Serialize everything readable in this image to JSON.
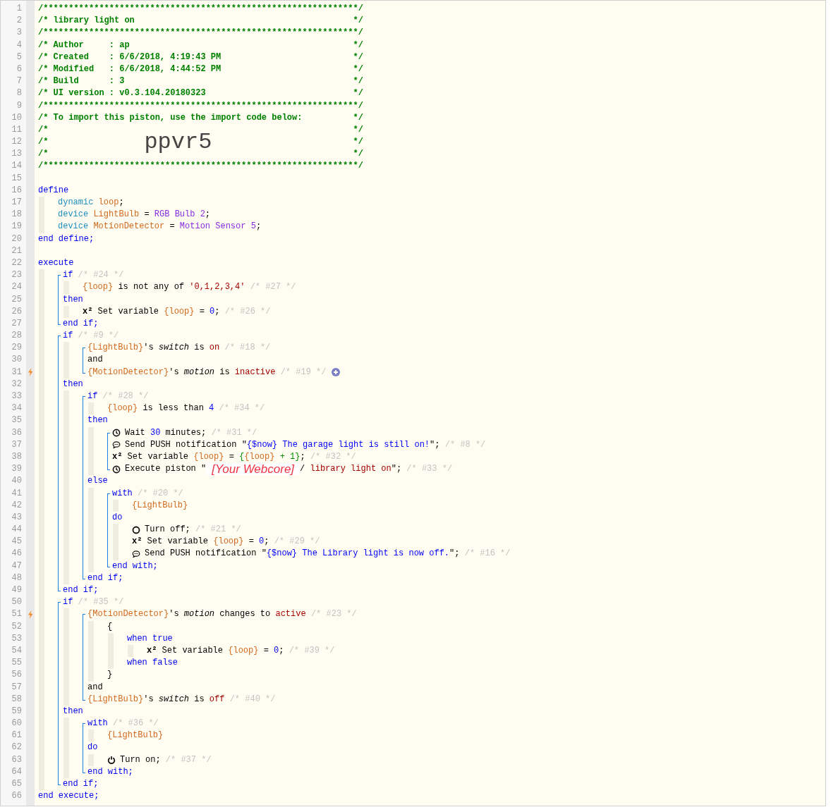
{
  "editor": {
    "lines": [
      {
        "n": "1",
        "tokens": [
          {
            "kind": "hdr",
            "text": "/**************************************************************/"
          }
        ]
      },
      {
        "n": "2",
        "tokens": [
          {
            "kind": "hdr",
            "text": "/* library light on"
          },
          {
            "kind": "hdr_end",
            "text": "*/"
          }
        ]
      },
      {
        "n": "3",
        "tokens": [
          {
            "kind": "hdr",
            "text": "/**************************************************************/"
          }
        ]
      },
      {
        "n": "4",
        "tokens": [
          {
            "kind": "hdr",
            "text": "/* Author     : ap"
          },
          {
            "kind": "hdr_end",
            "text": "*/"
          }
        ]
      },
      {
        "n": "5",
        "tokens": [
          {
            "kind": "hdr",
            "text": "/* Created    : 6/6/2018, 4:19:43 PM"
          },
          {
            "kind": "hdr_end",
            "text": "*/"
          }
        ]
      },
      {
        "n": "6",
        "tokens": [
          {
            "kind": "hdr",
            "text": "/* Modified   : 6/6/2018, 4:44:52 PM"
          },
          {
            "kind": "hdr_end",
            "text": "*/"
          }
        ]
      },
      {
        "n": "7",
        "tokens": [
          {
            "kind": "hdr",
            "text": "/* Build      : 3"
          },
          {
            "kind": "hdr_end",
            "text": "*/"
          }
        ]
      },
      {
        "n": "8",
        "tokens": [
          {
            "kind": "hdr",
            "text": "/* UI version : v0.3.104.20180323"
          },
          {
            "kind": "hdr_end",
            "text": "*/"
          }
        ]
      },
      {
        "n": "9",
        "tokens": [
          {
            "kind": "hdr",
            "text": "/**************************************************************/"
          }
        ]
      },
      {
        "n": "10",
        "tokens": [
          {
            "kind": "hdr",
            "text": "/* To import this piston, use the import code below:"
          },
          {
            "kind": "hdr_end",
            "text": "*/"
          }
        ]
      },
      {
        "n": "11",
        "tokens": [
          {
            "kind": "hdr",
            "text": "/*"
          },
          {
            "kind": "hdr_end",
            "text": "*/"
          }
        ]
      },
      {
        "n": "12",
        "tokens": [
          {
            "kind": "hdr",
            "text": "/*"
          },
          {
            "kind": "big",
            "text": "ppvr5"
          },
          {
            "kind": "hdr_end",
            "text": "*/"
          }
        ]
      },
      {
        "n": "13",
        "tokens": [
          {
            "kind": "hdr",
            "text": "/*"
          },
          {
            "kind": "hdr_end",
            "text": "*/"
          }
        ]
      },
      {
        "n": "14",
        "tokens": [
          {
            "kind": "hdr",
            "text": "/**************************************************************/"
          }
        ]
      },
      {
        "n": "15"
      },
      {
        "n": "16",
        "tokens": [
          {
            "kind": "kw",
            "text": "define"
          }
        ],
        "children": [
          {
            "n": "17",
            "tokens": [
              {
                "kind": "type",
                "text": "dynamic"
              },
              {
                "kind": "var",
                "text": " loop"
              },
              {
                "kind": "txt",
                "text": ";"
              }
            ]
          },
          {
            "n": "18",
            "tokens": [
              {
                "kind": "type",
                "text": "device"
              },
              {
                "kind": "var",
                "text": " LightBulb"
              },
              {
                "kind": "txt",
                "text": " = "
              },
              {
                "kind": "dev",
                "text": "RGB Bulb 2"
              },
              {
                "kind": "txt",
                "text": ";"
              }
            ]
          },
          {
            "n": "19",
            "tokens": [
              {
                "kind": "type",
                "text": "device"
              },
              {
                "kind": "var",
                "text": " MotionDetector"
              },
              {
                "kind": "txt",
                "text": " = "
              },
              {
                "kind": "dev",
                "text": "Motion Sensor 5"
              },
              {
                "kind": "txt",
                "text": ";"
              }
            ]
          }
        ]
      },
      {
        "n": "20",
        "tokens": [
          {
            "kind": "kw",
            "text": "end define;"
          }
        ]
      },
      {
        "n": "21"
      },
      {
        "n": "22",
        "tokens": [
          {
            "kind": "kw",
            "text": "execute"
          }
        ],
        "children": [
          {
            "bracket": [
              {
                "n": "23",
                "tokens": [
                  {
                    "kind": "kw",
                    "text": "if"
                  },
                  {
                    "kind": "cmt",
                    "text": " /* #24 */"
                  }
                ],
                "children": [
                  {
                    "n": "24",
                    "tokens": [
                      {
                        "kind": "var",
                        "text": "{loop}"
                      },
                      {
                        "kind": "txt",
                        "text": " is not any of "
                      },
                      {
                        "kind": "val",
                        "text": "'0,1,2,3,4'"
                      },
                      {
                        "kind": "cmt",
                        "text": " /* #27 */"
                      }
                    ]
                  }
                ]
              },
              {
                "n": "25",
                "tokens": [
                  {
                    "kind": "kw",
                    "text": "then"
                  }
                ],
                "children": [
                  {
                    "n": "26",
                    "tokens": [
                      {
                        "kind": "sq",
                        "text": "x²"
                      },
                      {
                        "kind": "txt",
                        "text": " Set variable "
                      },
                      {
                        "kind": "var",
                        "text": "{loop}"
                      },
                      {
                        "kind": "txt",
                        "text": " = "
                      },
                      {
                        "kind": "num",
                        "text": "0"
                      },
                      {
                        "kind": "txt",
                        "text": ";"
                      },
                      {
                        "kind": "cmt",
                        "text": " /* #26 */"
                      }
                    ]
                  }
                ]
              },
              {
                "n": "27",
                "tokens": [
                  {
                    "kind": "kw",
                    "text": "end if;"
                  }
                ]
              }
            ]
          },
          {
            "bracket": [
              {
                "n": "28",
                "tokens": [
                  {
                    "kind": "kw",
                    "text": "if"
                  },
                  {
                    "kind": "cmt",
                    "text": " /* #9 */"
                  }
                ],
                "children": [
                  {
                    "bracket": [
                      {
                        "n": "29",
                        "tokens": [
                          {
                            "kind": "var",
                            "text": "{LightBulb}"
                          },
                          {
                            "kind": "txt",
                            "text": "'s "
                          },
                          {
                            "kind": "it",
                            "text": "switch"
                          },
                          {
                            "kind": "txt",
                            "text": " is "
                          },
                          {
                            "kind": "val",
                            "text": "on"
                          },
                          {
                            "kind": "cmt",
                            "text": " /* #18 */"
                          }
                        ]
                      },
                      {
                        "n": "30",
                        "tokens": [
                          {
                            "kind": "txt",
                            "text": "and"
                          }
                        ]
                      },
                      {
                        "n": "31",
                        "trigger": true,
                        "tokens": [
                          {
                            "kind": "var",
                            "text": "{MotionDetector}"
                          },
                          {
                            "kind": "txt",
                            "text": "'s "
                          },
                          {
                            "kind": "it",
                            "text": "motion"
                          },
                          {
                            "kind": "txt",
                            "text": " is "
                          },
                          {
                            "kind": "val",
                            "text": "inactive"
                          },
                          {
                            "kind": "cmt",
                            "text": " /* #19 */"
                          },
                          {
                            "kind": "plus"
                          }
                        ]
                      }
                    ]
                  }
                ]
              },
              {
                "n": "32",
                "tokens": [
                  {
                    "kind": "kw",
                    "text": "then"
                  }
                ],
                "children": [
                  {
                    "bracket": [
                      {
                        "n": "33",
                        "tokens": [
                          {
                            "kind": "kw",
                            "text": "if"
                          },
                          {
                            "kind": "cmt",
                            "text": " /* #28 */"
                          }
                        ],
                        "children": [
                          {
                            "n": "34",
                            "tokens": [
                              {
                                "kind": "var",
                                "text": "{loop}"
                              },
                              {
                                "kind": "txt",
                                "text": " is less than "
                              },
                              {
                                "kind": "num",
                                "text": "4"
                              },
                              {
                                "kind": "cmt",
                                "text": " /* #34 */"
                              }
                            ]
                          }
                        ]
                      },
                      {
                        "n": "35",
                        "tokens": [
                          {
                            "kind": "kw",
                            "text": "then"
                          }
                        ],
                        "children": [
                          {
                            "bracket": [
                              {
                                "n": "36",
                                "tokens": [
                                  {
                                    "kind": "clock"
                                  },
                                  {
                                    "kind": "txt",
                                    "text": "Wait "
                                  },
                                  {
                                    "kind": "num",
                                    "text": "30"
                                  },
                                  {
                                    "kind": "txt",
                                    "text": " minutes;"
                                  },
                                  {
                                    "kind": "cmt",
                                    "text": " /* #31 */"
                                  }
                                ]
                              },
                              {
                                "n": "37",
                                "tokens": [
                                  {
                                    "kind": "bubble"
                                  },
                                  {
                                    "kind": "txt",
                                    "text": "Send PUSH notification \""
                                  },
                                  {
                                    "kind": "str",
                                    "text": "{$now} The garage light is still on!"
                                  },
                                  {
                                    "kind": "txt",
                                    "text": "\";"
                                  },
                                  {
                                    "kind": "cmt",
                                    "text": " /* #8 */"
                                  }
                                ]
                              },
                              {
                                "n": "38",
                                "tokens": [
                                  {
                                    "kind": "sq",
                                    "text": "x²"
                                  },
                                  {
                                    "kind": "txt",
                                    "text": " Set variable "
                                  },
                                  {
                                    "kind": "var",
                                    "text": "{loop}"
                                  },
                                  {
                                    "kind": "txt",
                                    "text": " = "
                                  },
                                  {
                                    "kind": "expr",
                                    "text": "{"
                                  },
                                  {
                                    "kind": "var",
                                    "text": "{loop}"
                                  },
                                  {
                                    "kind": "expr",
                                    "text": " + 1}"
                                  },
                                  {
                                    "kind": "txt",
                                    "text": ";"
                                  },
                                  {
                                    "kind": "cmt",
                                    "text": " /* #32 */"
                                  }
                                ]
                              },
                              {
                                "n": "39",
                                "tokens": [
                                  {
                                    "kind": "clock"
                                  },
                                  {
                                    "kind": "txt",
                                    "text": "Execute piston \""
                                  },
                                  {
                                    "kind": "redact",
                                    "text": "[Your Webcore]"
                                  },
                                  {
                                    "kind": "txt",
                                    "text": "/"
                                  },
                                  {
                                    "kind": "val",
                                    "text": " library light on"
                                  },
                                  {
                                    "kind": "txt",
                                    "text": "\";"
                                  },
                                  {
                                    "kind": "cmt",
                                    "text": " /* #33 */"
                                  }
                                ]
                              }
                            ]
                          }
                        ]
                      },
                      {
                        "n": "40",
                        "tokens": [
                          {
                            "kind": "kw",
                            "text": "else"
                          }
                        ],
                        "children": [
                          {
                            "bracket": [
                              {
                                "n": "41",
                                "tokens": [
                                  {
                                    "kind": "kw",
                                    "text": "with"
                                  },
                                  {
                                    "kind": "cmt",
                                    "text": " /* #20 */"
                                  }
                                ],
                                "children": [
                                  {
                                    "n": "42",
                                    "tokens": [
                                      {
                                        "kind": "var",
                                        "text": "{LightBulb}"
                                      }
                                    ]
                                  }
                                ]
                              },
                              {
                                "n": "43",
                                "tokens": [
                                  {
                                    "kind": "kw",
                                    "text": "do"
                                  }
                                ],
                                "children": [
                                  {
                                    "n": "44",
                                    "tokens": [
                                      {
                                        "kind": "circle"
                                      },
                                      {
                                        "kind": "txt",
                                        "text": "Turn off;"
                                      },
                                      {
                                        "kind": "cmt",
                                        "text": " /* #21 */"
                                      }
                                    ]
                                  },
                                  {
                                    "n": "45",
                                    "tokens": [
                                      {
                                        "kind": "sq",
                                        "text": "x²"
                                      },
                                      {
                                        "kind": "txt",
                                        "text": " Set variable "
                                      },
                                      {
                                        "kind": "var",
                                        "text": "{loop}"
                                      },
                                      {
                                        "kind": "txt",
                                        "text": " = "
                                      },
                                      {
                                        "kind": "num",
                                        "text": "0"
                                      },
                                      {
                                        "kind": "txt",
                                        "text": ";"
                                      },
                                      {
                                        "kind": "cmt",
                                        "text": " /* #29 */"
                                      }
                                    ]
                                  },
                                  {
                                    "n": "46",
                                    "tokens": [
                                      {
                                        "kind": "bubble"
                                      },
                                      {
                                        "kind": "txt",
                                        "text": "Send PUSH notification \""
                                      },
                                      {
                                        "kind": "str",
                                        "text": "{$now} The Library light is now off."
                                      },
                                      {
                                        "kind": "txt",
                                        "text": "\";"
                                      },
                                      {
                                        "kind": "cmt",
                                        "text": " /* #16 */"
                                      }
                                    ]
                                  }
                                ]
                              },
                              {
                                "n": "47",
                                "tokens": [
                                  {
                                    "kind": "kw",
                                    "text": "end with;"
                                  }
                                ]
                              }
                            ]
                          }
                        ]
                      },
                      {
                        "n": "48",
                        "tokens": [
                          {
                            "kind": "kw",
                            "text": "end if;"
                          }
                        ]
                      }
                    ]
                  }
                ]
              },
              {
                "n": "49",
                "tokens": [
                  {
                    "kind": "kw",
                    "text": "end if;"
                  }
                ]
              }
            ]
          },
          {
            "bracket": [
              {
                "n": "50",
                "tokens": [
                  {
                    "kind": "kw",
                    "text": "if"
                  },
                  {
                    "kind": "cmt",
                    "text": " /* #35 */"
                  }
                ],
                "children": [
                  {
                    "bracket": [
                      {
                        "n": "51",
                        "trigger": true,
                        "tokens": [
                          {
                            "kind": "var",
                            "text": "{MotionDetector}"
                          },
                          {
                            "kind": "txt",
                            "text": "'s "
                          },
                          {
                            "kind": "it",
                            "text": "motion"
                          },
                          {
                            "kind": "txt",
                            "text": " changes to "
                          },
                          {
                            "kind": "val",
                            "text": "active"
                          },
                          {
                            "kind": "cmt",
                            "text": " /* #23 */"
                          }
                        ],
                        "children": [
                          {
                            "n": "52",
                            "tokens": [
                              {
                                "kind": "txt",
                                "text": "{"
                              }
                            ],
                            "children": [
                              {
                                "n": "53",
                                "tokens": [
                                  {
                                    "kind": "kw",
                                    "text": "when true"
                                  }
                                ],
                                "children": [
                                  {
                                    "n": "54",
                                    "tokens": [
                                      {
                                        "kind": "sq",
                                        "text": "x²"
                                      },
                                      {
                                        "kind": "txt",
                                        "text": " Set variable "
                                      },
                                      {
                                        "kind": "var",
                                        "text": "{loop}"
                                      },
                                      {
                                        "kind": "txt",
                                        "text": " = "
                                      },
                                      {
                                        "kind": "num",
                                        "text": "0"
                                      },
                                      {
                                        "kind": "txt",
                                        "text": ";"
                                      },
                                      {
                                        "kind": "cmt",
                                        "text": " /* #39 */"
                                      }
                                    ]
                                  }
                                ]
                              },
                              {
                                "n": "55",
                                "tokens": [
                                  {
                                    "kind": "kw",
                                    "text": "when false"
                                  }
                                ]
                              }
                            ]
                          },
                          {
                            "n": "56",
                            "tokens": [
                              {
                                "kind": "txt",
                                "text": "}"
                              }
                            ]
                          }
                        ]
                      },
                      {
                        "n": "57",
                        "tokens": [
                          {
                            "kind": "txt",
                            "text": "and"
                          }
                        ]
                      },
                      {
                        "n": "58",
                        "tokens": [
                          {
                            "kind": "var",
                            "text": "{LightBulb}"
                          },
                          {
                            "kind": "txt",
                            "text": "'s "
                          },
                          {
                            "kind": "it",
                            "text": "switch"
                          },
                          {
                            "kind": "txt",
                            "text": " is "
                          },
                          {
                            "kind": "val",
                            "text": "off"
                          },
                          {
                            "kind": "cmt",
                            "text": " /* #40 */"
                          }
                        ]
                      }
                    ]
                  }
                ]
              },
              {
                "n": "59",
                "tokens": [
                  {
                    "kind": "kw",
                    "text": "then"
                  }
                ],
                "children": [
                  {
                    "bracket": [
                      {
                        "n": "60",
                        "tokens": [
                          {
                            "kind": "kw",
                            "text": "with"
                          },
                          {
                            "kind": "cmt",
                            "text": " /* #36 */"
                          }
                        ],
                        "children": [
                          {
                            "n": "61",
                            "tokens": [
                              {
                                "kind": "var",
                                "text": "{LightBulb}"
                              }
                            ]
                          }
                        ]
                      },
                      {
                        "n": "62",
                        "tokens": [
                          {
                            "kind": "kw",
                            "text": "do"
                          }
                        ],
                        "children": [
                          {
                            "n": "63",
                            "tokens": [
                              {
                                "kind": "power"
                              },
                              {
                                "kind": "txt",
                                "text": "Turn on;"
                              },
                              {
                                "kind": "cmt",
                                "text": " /* #37 */"
                              }
                            ]
                          }
                        ]
                      },
                      {
                        "n": "64",
                        "tokens": [
                          {
                            "kind": "kw",
                            "text": "end with;"
                          }
                        ]
                      }
                    ]
                  }
                ]
              },
              {
                "n": "65",
                "tokens": [
                  {
                    "kind": "kw",
                    "text": "end if;"
                  }
                ]
              }
            ]
          }
        ]
      },
      {
        "n": "66",
        "tokens": [
          {
            "kind": "kw",
            "text": "end execute;"
          }
        ]
      }
    ]
  }
}
